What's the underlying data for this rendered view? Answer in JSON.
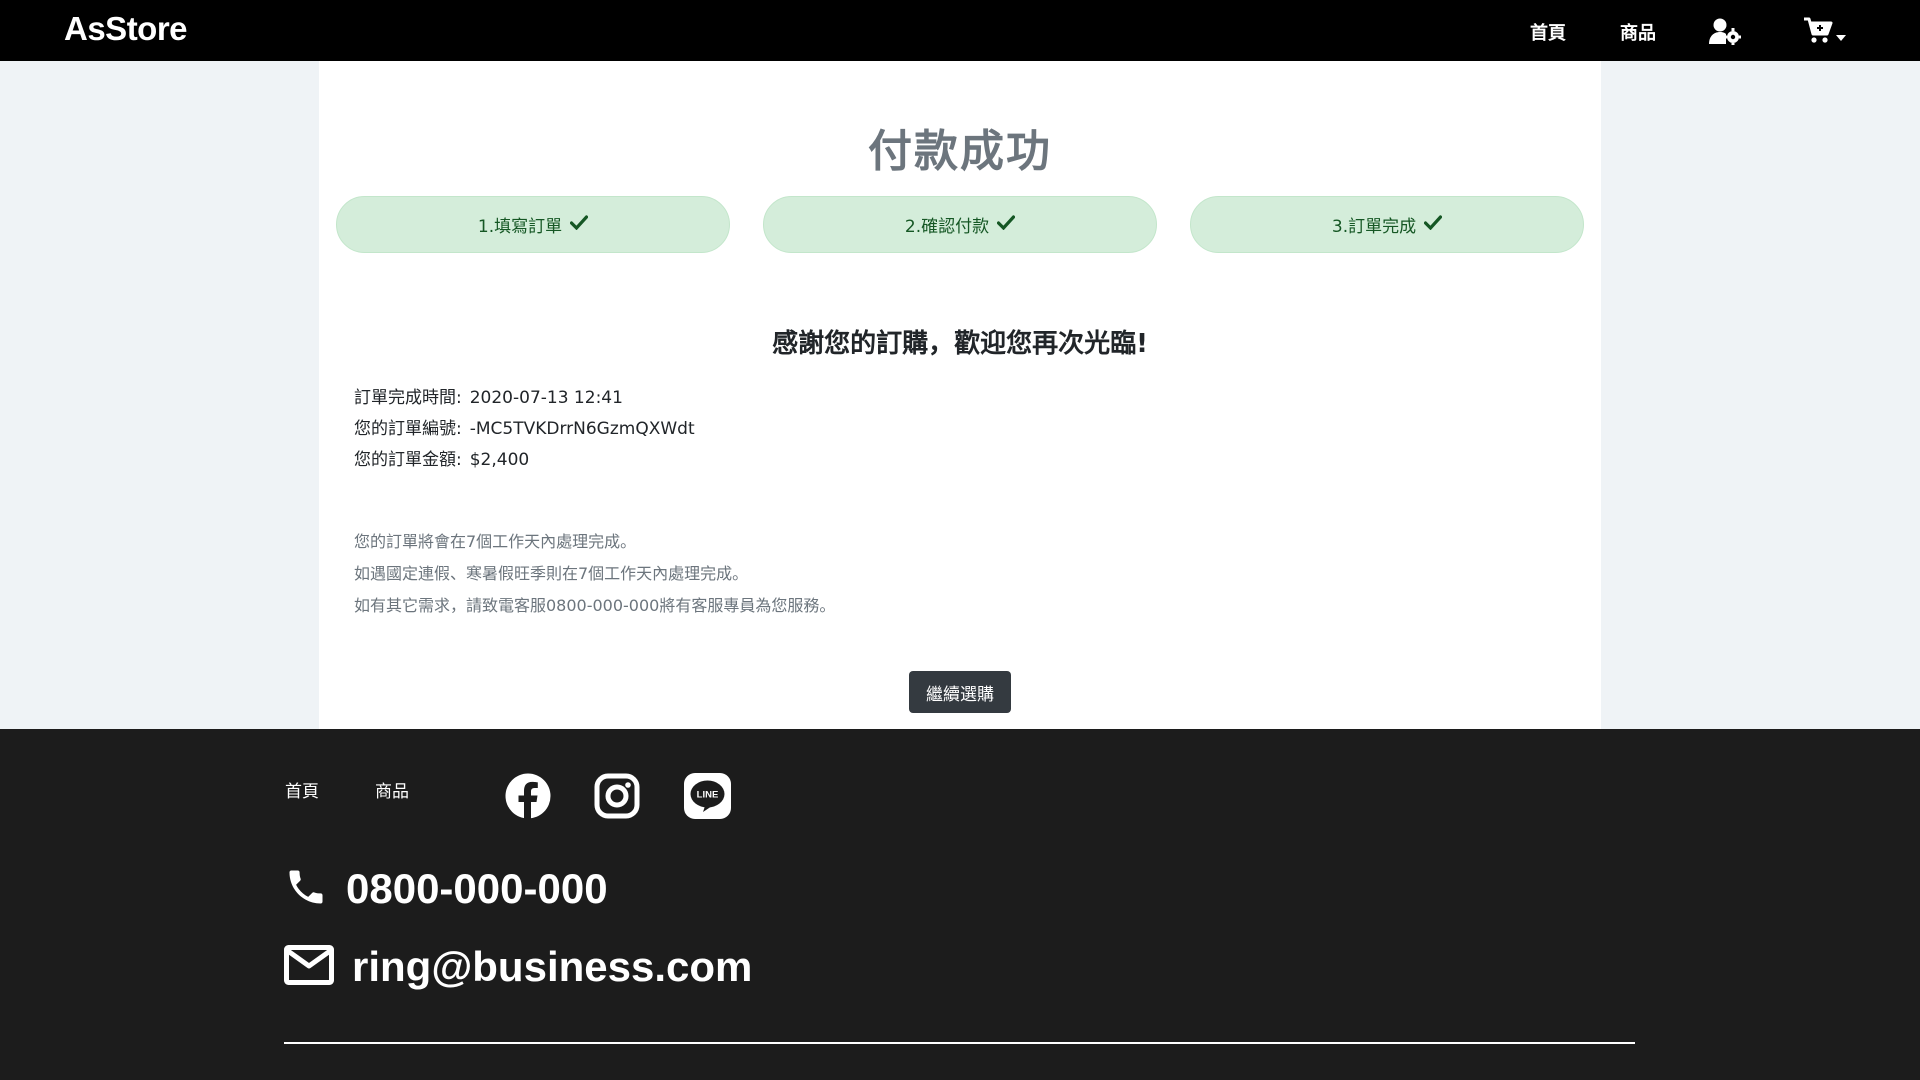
{
  "navbar": {
    "brand": "AsStore",
    "links": [
      "首頁",
      "商品"
    ],
    "icons": [
      "user-cog-icon",
      "cart-icon",
      "caret-down-icon"
    ]
  },
  "page": {
    "title": "付款成功",
    "steps": [
      {
        "label": "1.填寫訂單",
        "icon": "check-icon"
      },
      {
        "label": "2.確認付款",
        "icon": "check-icon"
      },
      {
        "label": "3.訂單完成",
        "icon": "check-icon"
      }
    ],
    "thanks": "感謝您的訂購，歡迎您再次光臨!",
    "order": {
      "time_label": "訂單完成時間:",
      "time_value": "2020-07-13 12:41",
      "id_label": "您的訂單編號:",
      "id_value": "-MC5TVKDrrN6GzmQXWdt",
      "amount_label": "您的訂單金額:",
      "amount_value": "$2,400"
    },
    "notes": [
      "您的訂單將會在7個工作天內處理完成。",
      "如遇國定連假、寒暑假旺季則在7個工作天內處理完成。",
      "如有其它需求，請致電客服0800-000-000將有客服專員為您服務。"
    ],
    "continue_button": "繼續選購"
  },
  "footer": {
    "links": [
      "首頁",
      "商品"
    ],
    "social_icons": [
      "facebook-icon",
      "instagram-icon",
      "line-icon"
    ],
    "phone": "0800-000-000",
    "email": "ring@business.com",
    "colors": {
      "background": "#1c1c1c"
    }
  },
  "colors": {
    "navbar": "#000000",
    "step_bg": "#d4edda",
    "step_text": "#155724",
    "button": "#343a40",
    "page_bg": "#eff3f6"
  }
}
